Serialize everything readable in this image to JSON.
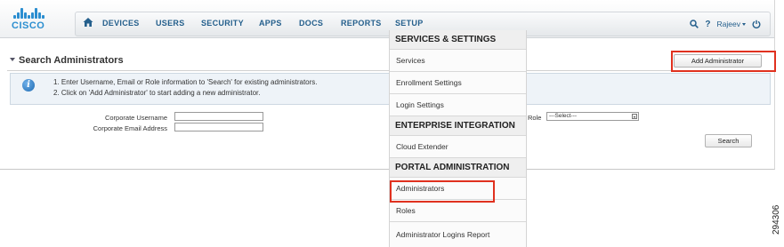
{
  "brand": {
    "logo_text": "CISCO",
    "accent": "#2b8ed0"
  },
  "nav": {
    "home_icon": "home-icon",
    "items": [
      "DEVICES",
      "USERS",
      "SECURITY",
      "APPS",
      "DOCS",
      "REPORTS",
      "SETUP"
    ],
    "user_name": "Rajeev",
    "icons": [
      "search-icon",
      "help-icon",
      "user-menu-caret-icon",
      "power-icon"
    ],
    "help_label": "?"
  },
  "page": {
    "title": "Search Administrators",
    "add_button": "Add Administrator",
    "info_lines": [
      "1. Enter Username, Email or Role information to 'Search' for existing administrators.",
      "2. Click on 'Add Administrator' to start adding a new administrator."
    ]
  },
  "form": {
    "username_label": "Corporate Username",
    "username_value": "",
    "email_label": "Corporate Email Address",
    "email_value": "",
    "role_label": "Role",
    "role_selected": "---Select---",
    "search_button": "Search"
  },
  "setup_menu": {
    "sections": [
      {
        "header": "SERVICES & SETTINGS",
        "items": [
          "Services",
          "Enrollment Settings",
          "Login Settings"
        ]
      },
      {
        "header": "ENTERPRISE INTEGRATION",
        "items": [
          "Cloud Extender"
        ]
      },
      {
        "header": "PORTAL ADMINISTRATION",
        "items": [
          "Administrators",
          "Roles",
          "Administrator Logins Report"
        ]
      }
    ]
  },
  "highlight_color": "#e0311f",
  "figure_id": "294306"
}
